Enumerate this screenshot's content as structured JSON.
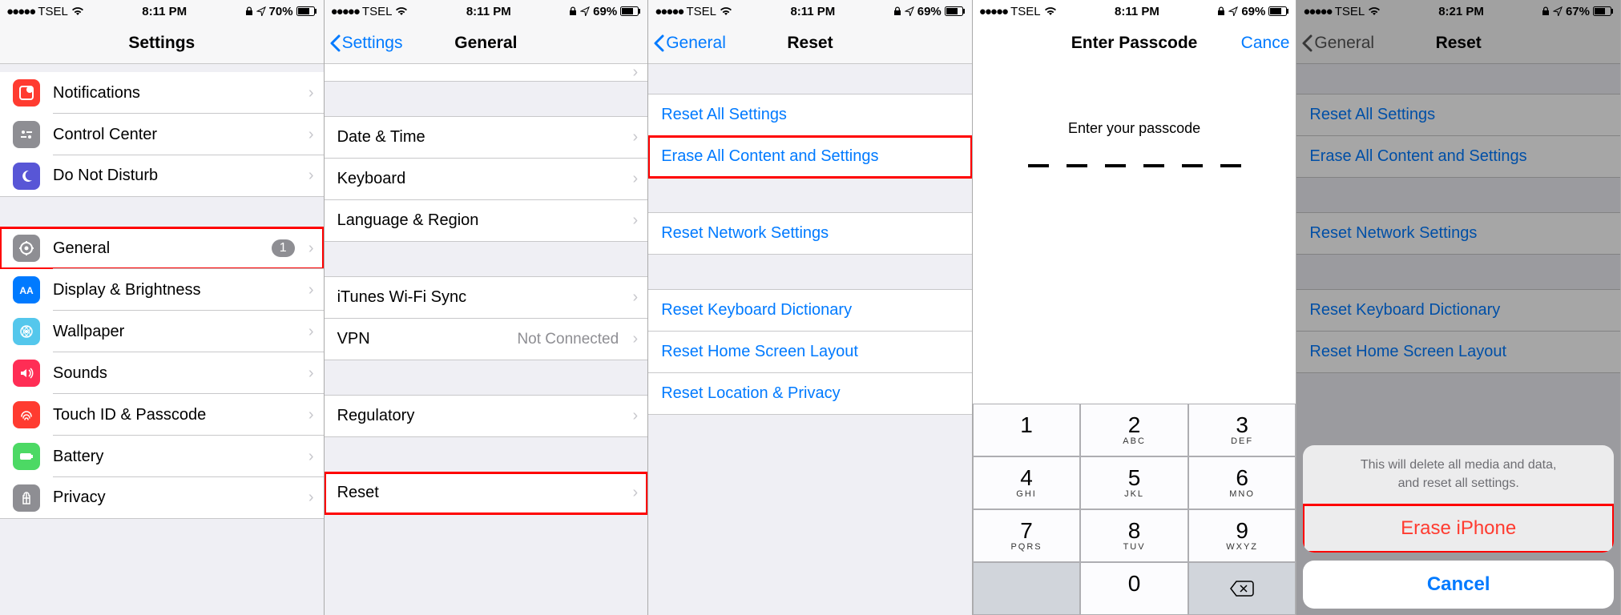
{
  "screens": [
    {
      "status": {
        "carrier": "TSEL",
        "time": "8:11 PM",
        "battery": "70%"
      },
      "nav": {
        "title": "Settings"
      },
      "items": [
        {
          "icon": "notifications",
          "color": "#ff3b30",
          "label": "Notifications"
        },
        {
          "icon": "control",
          "color": "#8e8e93",
          "label": "Control Center"
        },
        {
          "icon": "dnd",
          "color": "#5856d6",
          "label": "Do Not Disturb"
        }
      ],
      "group2": [
        {
          "icon": "general",
          "color": "#8e8e93",
          "label": "General",
          "badge": "1",
          "highlight": true
        },
        {
          "icon": "display",
          "color": "#007aff",
          "label": "Display & Brightness"
        },
        {
          "icon": "wallpaper",
          "color": "#54c7ec",
          "label": "Wallpaper"
        },
        {
          "icon": "sounds",
          "color": "#ff2d55",
          "label": "Sounds"
        },
        {
          "icon": "touchid",
          "color": "#ff3b30",
          "label": "Touch ID & Passcode"
        },
        {
          "icon": "battery",
          "color": "#4cd964",
          "label": "Battery"
        },
        {
          "icon": "privacy",
          "color": "#8e8e93",
          "label": "Privacy"
        }
      ]
    },
    {
      "status": {
        "carrier": "TSEL",
        "time": "8:11 PM",
        "battery": "69%"
      },
      "nav": {
        "back": "Settings",
        "title": "General"
      },
      "rows": [
        {
          "label": "Date & Time"
        },
        {
          "label": "Keyboard"
        },
        {
          "label": "Language & Region"
        }
      ],
      "rows2": [
        {
          "label": "iTunes Wi-Fi Sync"
        },
        {
          "label": "VPN",
          "value": "Not Connected"
        }
      ],
      "rows3": [
        {
          "label": "Regulatory"
        }
      ],
      "rows4": [
        {
          "label": "Reset",
          "highlight": true
        }
      ]
    },
    {
      "status": {
        "carrier": "TSEL",
        "time": "8:11 PM",
        "battery": "69%"
      },
      "nav": {
        "back": "General",
        "title": "Reset"
      },
      "g1": [
        {
          "label": "Reset All Settings"
        },
        {
          "label": "Erase All Content and Settings",
          "highlight": true
        }
      ],
      "g2": [
        {
          "label": "Reset Network Settings"
        }
      ],
      "g3": [
        {
          "label": "Reset Keyboard Dictionary"
        },
        {
          "label": "Reset Home Screen Layout"
        },
        {
          "label": "Reset Location & Privacy"
        }
      ]
    },
    {
      "status": {
        "carrier": "TSEL",
        "time": "8:11 PM",
        "battery": "69%"
      },
      "nav": {
        "title": "Enter Passcode",
        "right": "Cance"
      },
      "prompt": "Enter your passcode",
      "keys": [
        {
          "n": "1",
          "l": ""
        },
        {
          "n": "2",
          "l": "ABC"
        },
        {
          "n": "3",
          "l": "DEF"
        },
        {
          "n": "4",
          "l": "GHI"
        },
        {
          "n": "5",
          "l": "JKL"
        },
        {
          "n": "6",
          "l": "MNO"
        },
        {
          "n": "7",
          "l": "PQRS"
        },
        {
          "n": "8",
          "l": "TUV"
        },
        {
          "n": "9",
          "l": "WXYZ"
        },
        {
          "blank": true
        },
        {
          "n": "0",
          "l": ""
        },
        {
          "back": true
        }
      ]
    },
    {
      "status": {
        "carrier": "TSEL",
        "time": "8:21 PM",
        "battery": "67%"
      },
      "nav": {
        "back": "General",
        "title": "Reset"
      },
      "g1": [
        {
          "label": "Reset All Settings"
        },
        {
          "label": "Erase All Content and Settings"
        }
      ],
      "g2": [
        {
          "label": "Reset Network Settings"
        }
      ],
      "g3": [
        {
          "label": "Reset Keyboard Dictionary"
        },
        {
          "label": "Reset Home Screen Layout"
        }
      ],
      "sheet": {
        "message": "This will delete all media and data,\nand reset all settings.",
        "destructive": "Erase iPhone",
        "cancel": "Cancel"
      }
    }
  ]
}
